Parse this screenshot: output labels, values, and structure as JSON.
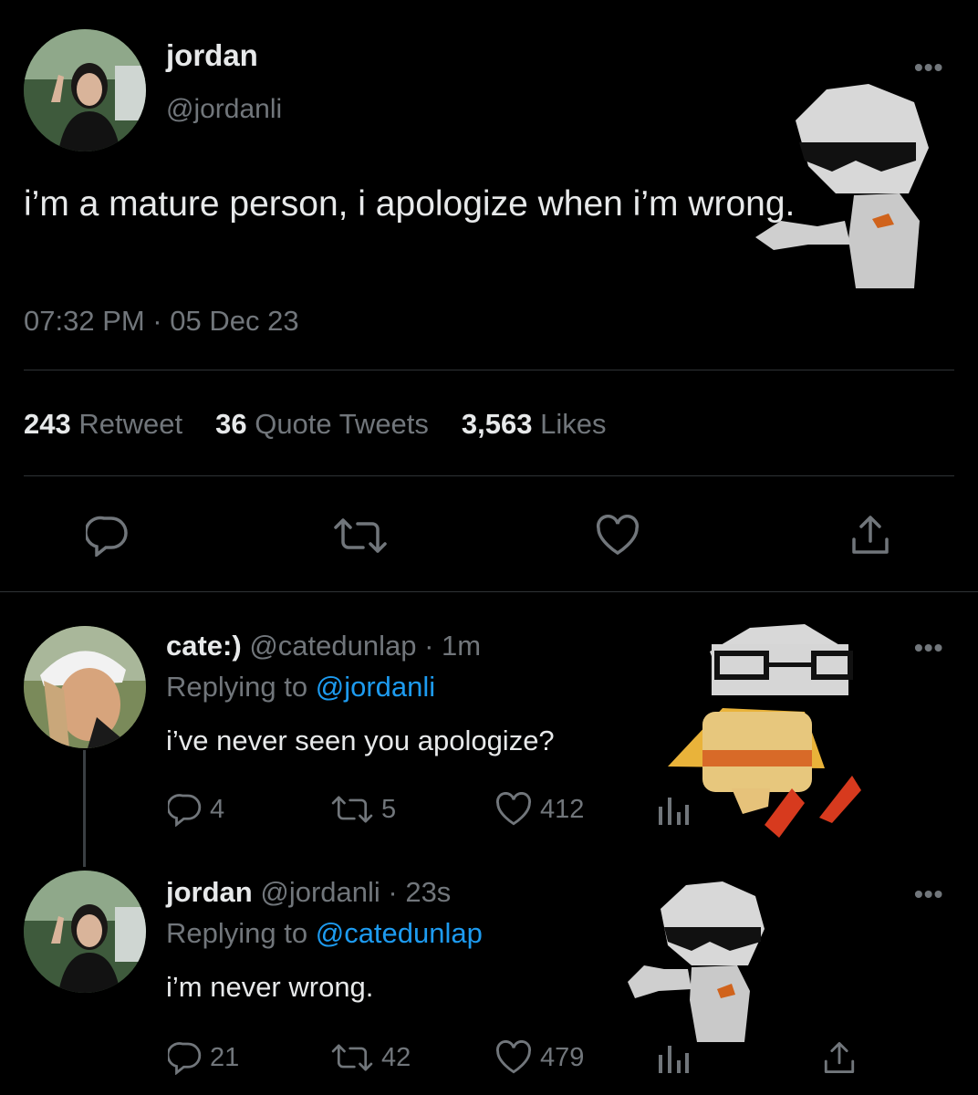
{
  "tweet": {
    "display_name": "jordan",
    "handle": "@jordanli",
    "text": "i’m a mature person, i apologize when i’m wrong.",
    "timestamp": "07:32 PM · 05 Dec 23",
    "stats": [
      {
        "count": "243",
        "label": "Retweet"
      },
      {
        "count": "36",
        "label": "Quote Tweets"
      },
      {
        "count": "3,563",
        "label": "Likes"
      }
    ]
  },
  "replies": [
    {
      "display_name": "cate:)",
      "meta": "@catedunlap · 1m",
      "replying_prefix": "Replying to ",
      "replying_handle": "@jordanli",
      "text": "i’ve never seen you apologize?",
      "reply_count": "4",
      "retweet_count": "5",
      "like_count": "412"
    },
    {
      "display_name": "jordan",
      "meta": "@jordanli · 23s",
      "replying_prefix": "Replying to ",
      "replying_handle": "@catedunlap",
      "text": "i’m never wrong.",
      "reply_count": "21",
      "retweet_count": "42",
      "like_count": "479"
    }
  ],
  "colors": {
    "background": "#000000",
    "text": "#e7e9ea",
    "muted": "#71767b",
    "link": "#1d9bf0",
    "divider": "#2f3336"
  },
  "icons": [
    "more-icon",
    "reply-icon",
    "retweet-icon",
    "like-icon",
    "share-icon",
    "analytics-icon"
  ]
}
